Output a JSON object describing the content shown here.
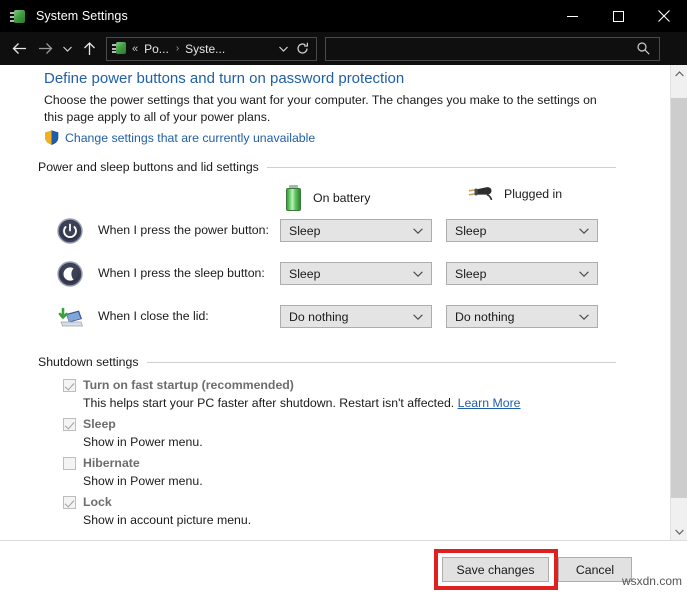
{
  "window": {
    "title": "System Settings",
    "icon": "system-settings-icon",
    "controls": {
      "minimize": "minimize-icon",
      "maximize": "maximize-icon",
      "close": "close-icon"
    }
  },
  "nav": {
    "back": "back-arrow-icon",
    "forward": "forward-arrow-icon",
    "recent": "chevron-down-icon",
    "up": "up-arrow-icon",
    "breadcrumb": {
      "icon": "system-settings-icon",
      "overflow": "«",
      "crumb1": "Po...",
      "separator": "›",
      "crumb2": "Syste...",
      "dropdown": "chevron-down-icon",
      "refresh": "refresh-icon"
    },
    "search": {
      "value": "",
      "placeholder": "",
      "icon": "search-icon"
    }
  },
  "page": {
    "title": "Define power buttons and turn on password protection",
    "description": "Choose the power settings that you want for your computer. The changes you make to the settings on this page apply to all of your power plans.",
    "uac_link": "Change settings that are currently unavailable",
    "uac_icon": "shield-icon"
  },
  "power_group": {
    "header": "Power and sleep buttons and lid settings",
    "columns": [
      {
        "label": "On battery",
        "icon": "battery-icon"
      },
      {
        "label": "Plugged in",
        "icon": "power-plug-icon"
      }
    ],
    "rows": [
      {
        "icon": "power-button-icon",
        "label": "When I press the power button:",
        "on_battery": "Sleep",
        "plugged_in": "Sleep"
      },
      {
        "icon": "sleep-moon-icon",
        "label": "When I press the sleep button:",
        "on_battery": "Sleep",
        "plugged_in": "Sleep"
      },
      {
        "icon": "laptop-lid-icon",
        "label": "When I close the lid:",
        "on_battery": "Do nothing",
        "plugged_in": "Do nothing"
      }
    ]
  },
  "shutdown_group": {
    "header": "Shutdown settings",
    "items": [
      {
        "label": "Turn on fast startup (recommended)",
        "checked": true,
        "disabled": true,
        "description": "This helps start your PC faster after shutdown. Restart isn't affected.",
        "link": "Learn More"
      },
      {
        "label": "Sleep",
        "checked": true,
        "disabled": true,
        "description": "Show in Power menu.",
        "link": ""
      },
      {
        "label": "Hibernate",
        "checked": false,
        "disabled": true,
        "description": "Show in Power menu.",
        "link": ""
      },
      {
        "label": "Lock",
        "checked": true,
        "disabled": true,
        "description": "Show in account picture menu.",
        "link": ""
      }
    ]
  },
  "footer": {
    "save_label": "Save changes",
    "cancel_label": "Cancel",
    "highlight_color": "#e02020"
  },
  "watermark": "wsxdn.com",
  "scrollbar": {
    "up": "scroll-up-icon",
    "down": "scroll-down-icon"
  },
  "colors": {
    "titlebar": "#000000",
    "link": "#1f5fa9",
    "combo_bg": "#e4e4e4",
    "button_bg": "#e1e1e1"
  }
}
